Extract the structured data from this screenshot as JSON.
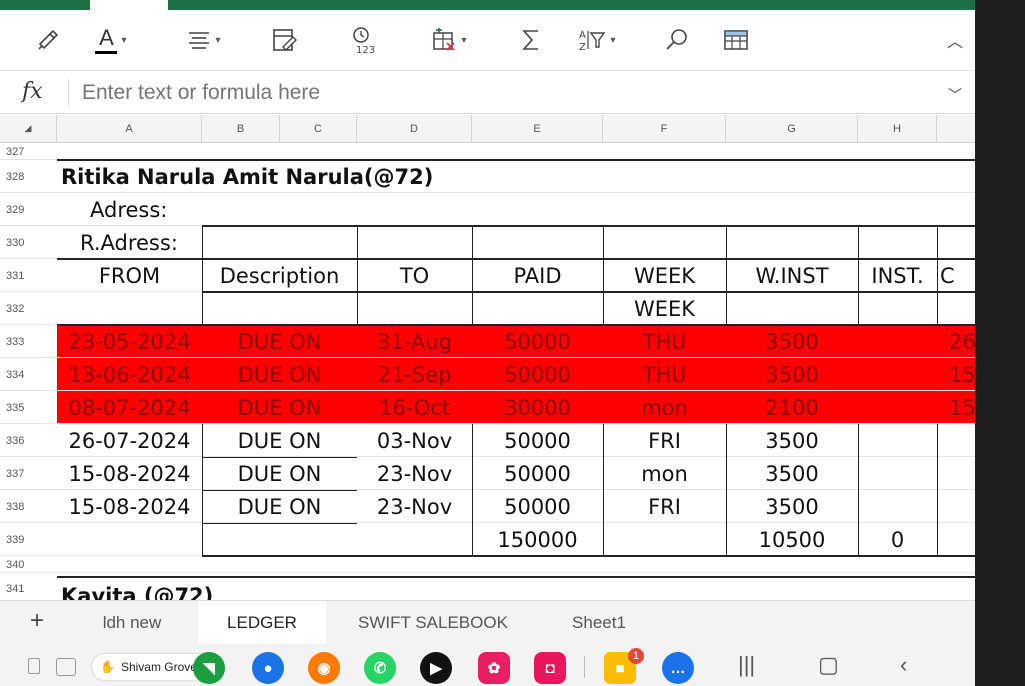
{
  "formula_bar": {
    "fx": "fx",
    "placeholder": "Enter text or formula here"
  },
  "columns": [
    "A",
    "B",
    "C",
    "D",
    "E",
    "F",
    "G",
    "H"
  ],
  "rows": [
    "327",
    "328",
    "329",
    "330",
    "331",
    "332",
    "333",
    "334",
    "335",
    "336",
    "337",
    "338",
    "339",
    "340",
    "341"
  ],
  "ledger": {
    "name": "Ritika Narula Amit Narula(@72)",
    "address_label": "Adress:",
    "raddress_label": "R.Adress:",
    "headers": {
      "from": "FROM",
      "description": "Description",
      "to": "TO",
      "paid": "PAID",
      "week": "WEEK",
      "winst": "W.INST",
      "inst": "INST.",
      "partial": "C"
    },
    "subheader_week": "WEEK",
    "entries": [
      {
        "from": "23-05-2024",
        "description": "DUE ON",
        "to": "31-Aug",
        "paid": "50000",
        "week": "THU",
        "winst": "3500",
        "extra": "26",
        "highlighted": true
      },
      {
        "from": "13-06-2024",
        "description": "DUE ON",
        "to": "21-Sep",
        "paid": "50000",
        "week": "THU",
        "winst": "3500",
        "extra": "15",
        "highlighted": true
      },
      {
        "from": "08-07-2024",
        "description": "DUE ON",
        "to": "16-Oct",
        "paid": "30000",
        "week": "mon",
        "winst": "2100",
        "extra": "15",
        "highlighted": true
      },
      {
        "from": "26-07-2024",
        "description": "DUE ON",
        "to": "03-Nov",
        "paid": "50000",
        "week": "FRI",
        "winst": "3500",
        "extra": "",
        "highlighted": false
      },
      {
        "from": "15-08-2024",
        "description": "DUE ON",
        "to": "23-Nov",
        "paid": "50000",
        "week": "mon",
        "winst": "3500",
        "extra": "",
        "highlighted": false
      },
      {
        "from": "15-08-2024",
        "description": "DUE ON",
        "to": "23-Nov",
        "paid": "50000",
        "week": "FRI",
        "winst": "3500",
        "extra": "",
        "highlighted": false
      }
    ],
    "totals": {
      "paid": "150000",
      "winst": "10500",
      "inst": "0"
    },
    "next_name": "Kavita (@72)"
  },
  "sheet_tabs": [
    "ldh new",
    "LEDGER",
    "SWIFT SALEBOOK",
    "Sheet1"
  ],
  "active_sheet": "LEDGER",
  "navbar": {
    "user": "Shivam Grover",
    "notification_count": "1"
  },
  "colors": {
    "excel_green": "#1e7145",
    "highlight_red": "#ff0000",
    "highlight_text": "#8b0000"
  }
}
